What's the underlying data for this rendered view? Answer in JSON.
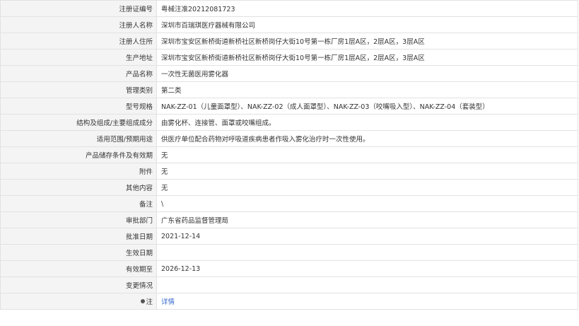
{
  "rows": [
    {
      "label": "注册证编号",
      "value": "粤械注准20212081723"
    },
    {
      "label": "注册人名称",
      "value": "深圳市百瑞琪医疗器械有限公司"
    },
    {
      "label": "注册人住所",
      "value": "深圳市宝安区新桥街道新桥社区新桥岗仔大街10号第一栋厂房1层A区，2层A区，3层A区"
    },
    {
      "label": "生产地址",
      "value": "深圳市宝安区新桥街道新桥社区新桥岗仔大街10号第一栋厂房1层A区，2层A区，3层A区"
    },
    {
      "label": "产品名称",
      "value": "一次性无菌医用雾化器"
    },
    {
      "label": "管理类别",
      "value": "第二类"
    },
    {
      "label": "型号规格",
      "value": "NAK-ZZ-01（儿童面罩型）、NAK-ZZ-02（成人面罩型）、NAK-ZZ-03（咬嘴吸入型）、NAK-ZZ-04（套装型）"
    },
    {
      "label": "结构及组成/主要组成成分",
      "value": "由雾化杯、连接管、面罩或咬嘴组成。"
    },
    {
      "label": "适用范围/预期用途",
      "value": "供医疗单位配合药物对呼吸道疾病患者作吸入雾化治疗时一次性使用。"
    },
    {
      "label": "产品储存条件及有效期",
      "value": "无"
    },
    {
      "label": "附件",
      "value": "无"
    },
    {
      "label": "其他内容",
      "value": "无"
    },
    {
      "label": "备注",
      "value": "\\"
    },
    {
      "label": "审批部门",
      "value": "广东省药品监督管理局"
    },
    {
      "label": "批准日期",
      "value": "2021-12-14"
    },
    {
      "label": "生效日期",
      "value": ""
    },
    {
      "label": "有效期至",
      "value": "2026-12-13"
    },
    {
      "label": "变更情况",
      "value": ""
    }
  ],
  "note": {
    "label": "注",
    "icon": "bullet-icon",
    "link_text": "详情",
    "link_color": "#3366cc"
  }
}
